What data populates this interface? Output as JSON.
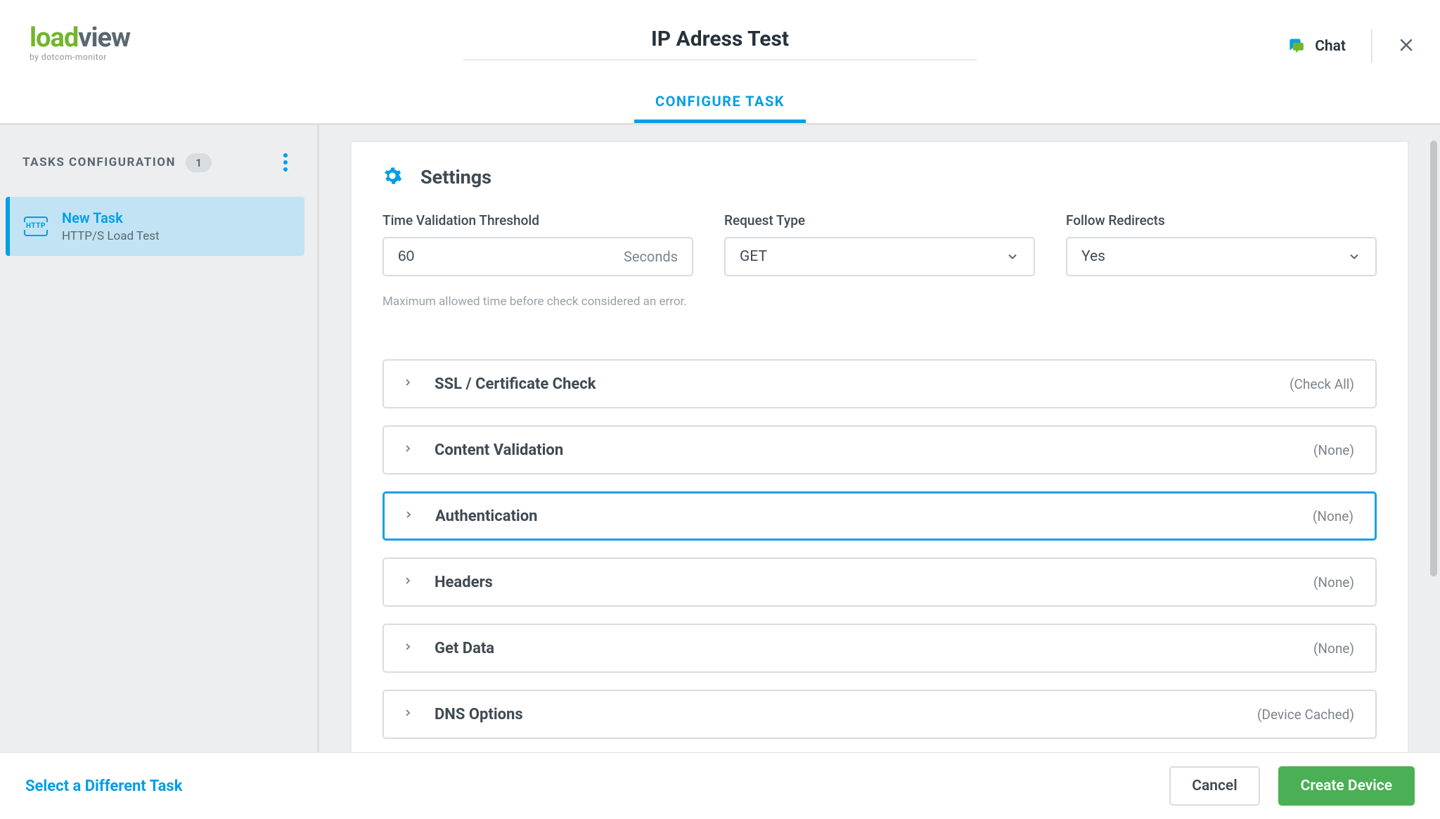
{
  "header": {
    "logo_primary": "load",
    "logo_secondary": "view",
    "logo_sub": "by dotcom-monitor",
    "title": "IP Adress Test",
    "chat_label": "Chat",
    "tab_label": "CONFIGURE TASK"
  },
  "sidebar": {
    "heading": "TASKS CONFIGURATION",
    "count": "1",
    "task": {
      "name": "New Task",
      "subtitle": "HTTP/S Load Test"
    }
  },
  "settings": {
    "title": "Settings",
    "time_threshold": {
      "label": "Time Validation Threshold",
      "value": "60",
      "unit": "Seconds",
      "help": "Maximum allowed time before check considered an error."
    },
    "request_type": {
      "label": "Request Type",
      "value": "GET"
    },
    "follow_redirects": {
      "label": "Follow Redirects",
      "value": "Yes"
    }
  },
  "accordion": [
    {
      "label": "SSL / Certificate Check",
      "status": "(Check All)",
      "focused": false
    },
    {
      "label": "Content Validation",
      "status": "(None)",
      "focused": false
    },
    {
      "label": "Authentication",
      "status": "(None)",
      "focused": true
    },
    {
      "label": "Headers",
      "status": "(None)",
      "focused": false
    },
    {
      "label": "Get Data",
      "status": "(None)",
      "focused": false
    },
    {
      "label": "DNS Options",
      "status": "(Device Cached)",
      "focused": false
    }
  ],
  "footer": {
    "select_task": "Select a Different Task",
    "cancel": "Cancel",
    "create": "Create Device"
  }
}
